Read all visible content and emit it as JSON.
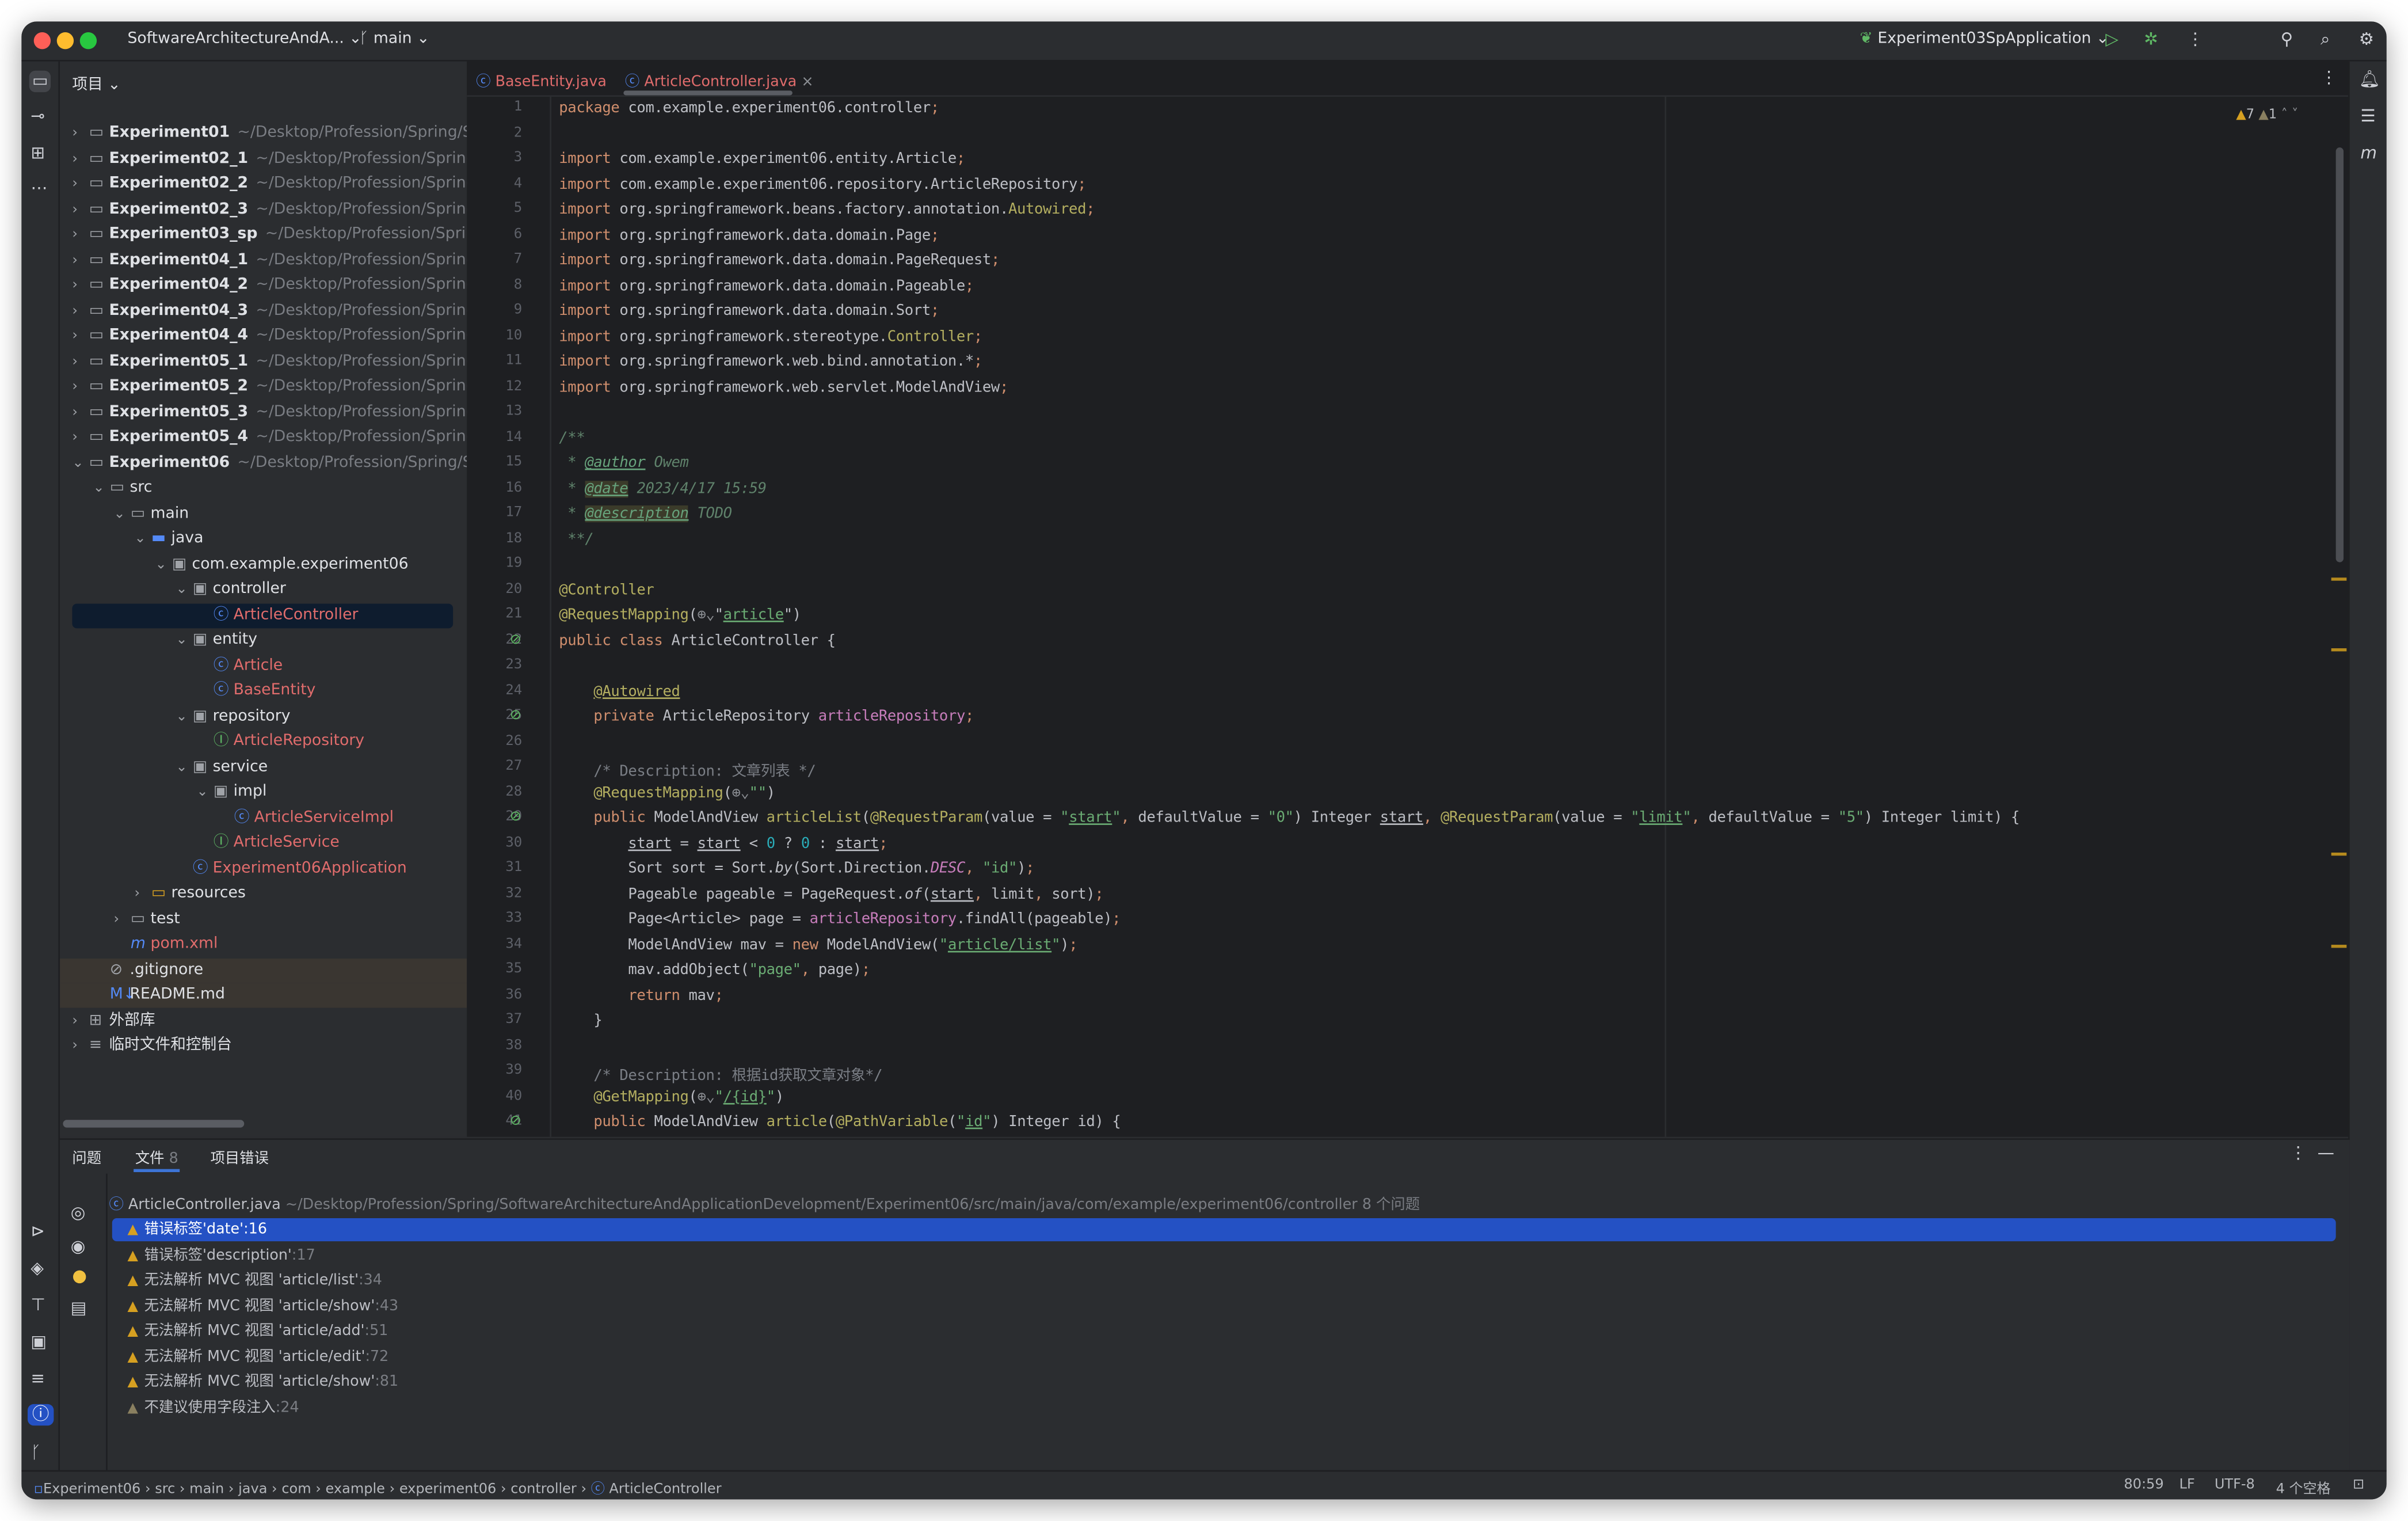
{
  "titlebar": {
    "project": "SoftwareArchitectureAndA...",
    "branch": "main",
    "run_config": "Experiment03SpApplication",
    "icons": [
      "run-icon",
      "debug-icon",
      "more-icon",
      "add-user-icon",
      "search-icon",
      "settings-icon"
    ]
  },
  "colors": {
    "accent": "#548af7",
    "selection": "#2451c4",
    "warning": "#d6a021",
    "error_file": "#e06c6c",
    "run": "#5fb865"
  },
  "project_panel": {
    "title": "项目",
    "tree": [
      {
        "depth": 0,
        "chev": ">",
        "icon": "module",
        "label": "Experiment01",
        "path": "~/Desktop/Profession/Spring/Softw",
        "bold": true
      },
      {
        "depth": 0,
        "chev": ">",
        "icon": "module",
        "label": "Experiment02_1",
        "path": "~/Desktop/Profession/Spring/Sof",
        "bold": true
      },
      {
        "depth": 0,
        "chev": ">",
        "icon": "module",
        "label": "Experiment02_2",
        "path": "~/Desktop/Profession/Spring/Sof",
        "bold": true
      },
      {
        "depth": 0,
        "chev": ">",
        "icon": "module",
        "label": "Experiment02_3",
        "path": "~/Desktop/Profession/Spring/Sof",
        "bold": true
      },
      {
        "depth": 0,
        "chev": ">",
        "icon": "module",
        "label": "Experiment03_sp",
        "path": "~/Desktop/Profession/Spring/Sc",
        "bold": true
      },
      {
        "depth": 0,
        "chev": ">",
        "icon": "module",
        "label": "Experiment04_1",
        "path": "~/Desktop/Profession/Spring/Sof",
        "bold": true
      },
      {
        "depth": 0,
        "chev": ">",
        "icon": "module",
        "label": "Experiment04_2",
        "path": "~/Desktop/Profession/Spring/Sof",
        "bold": true
      },
      {
        "depth": 0,
        "chev": ">",
        "icon": "module",
        "label": "Experiment04_3",
        "path": "~/Desktop/Profession/Spring/Sof",
        "bold": true
      },
      {
        "depth": 0,
        "chev": ">",
        "icon": "module",
        "label": "Experiment04_4",
        "path": "~/Desktop/Profession/Spring/Sof",
        "bold": true
      },
      {
        "depth": 0,
        "chev": ">",
        "icon": "module",
        "label": "Experiment05_1",
        "path": "~/Desktop/Profession/Spring/Sof",
        "bold": true
      },
      {
        "depth": 0,
        "chev": ">",
        "icon": "module",
        "label": "Experiment05_2",
        "path": "~/Desktop/Profession/Spring/Sof",
        "bold": true
      },
      {
        "depth": 0,
        "chev": ">",
        "icon": "module",
        "label": "Experiment05_3",
        "path": "~/Desktop/Profession/Spring/Sof",
        "bold": true
      },
      {
        "depth": 0,
        "chev": ">",
        "icon": "module",
        "label": "Experiment05_4",
        "path": "~/Desktop/Profession/Spring/Sof",
        "bold": true
      },
      {
        "depth": 0,
        "chev": "v",
        "icon": "module",
        "label": "Experiment06",
        "path": "~/Desktop/Profession/Spring/Softw",
        "bold": true
      },
      {
        "depth": 1,
        "chev": "v",
        "icon": "folder",
        "label": "src"
      },
      {
        "depth": 2,
        "chev": "v",
        "icon": "folder",
        "label": "main"
      },
      {
        "depth": 3,
        "chev": "v",
        "icon": "source-folder",
        "label": "java"
      },
      {
        "depth": 4,
        "chev": "v",
        "icon": "package",
        "label": "com.example.experiment06"
      },
      {
        "depth": 5,
        "chev": "v",
        "icon": "package",
        "label": "controller"
      },
      {
        "depth": 6,
        "chev": "",
        "icon": "class",
        "label": "ArticleController",
        "red": true,
        "selected": true
      },
      {
        "depth": 5,
        "chev": "v",
        "icon": "package",
        "label": "entity"
      },
      {
        "depth": 6,
        "chev": "",
        "icon": "class",
        "label": "Article",
        "red": true
      },
      {
        "depth": 6,
        "chev": "",
        "icon": "class",
        "label": "BaseEntity",
        "red": true
      },
      {
        "depth": 5,
        "chev": "v",
        "icon": "package",
        "label": "repository"
      },
      {
        "depth": 6,
        "chev": "",
        "icon": "interface",
        "label": "ArticleRepository",
        "red": true
      },
      {
        "depth": 5,
        "chev": "v",
        "icon": "package",
        "label": "service"
      },
      {
        "depth": 6,
        "chev": "v",
        "icon": "package",
        "label": "impl"
      },
      {
        "depth": 7,
        "chev": "",
        "icon": "class",
        "label": "ArticleServiceImpl",
        "red": true
      },
      {
        "depth": 6,
        "chev": "",
        "icon": "interface",
        "label": "ArticleService",
        "red": true
      },
      {
        "depth": 5,
        "chev": "",
        "icon": "spring-app",
        "label": "Experiment06Application",
        "red": true
      },
      {
        "depth": 3,
        "chev": ">",
        "icon": "resources-folder",
        "label": "resources"
      },
      {
        "depth": 2,
        "chev": ">",
        "icon": "folder",
        "label": "test"
      },
      {
        "depth": 2,
        "chev": "",
        "icon": "maven",
        "label": "pom.xml",
        "red": true
      },
      {
        "depth": 1,
        "chev": "",
        "icon": "ignore",
        "label": ".gitignore",
        "hl": true
      },
      {
        "depth": 1,
        "chev": "",
        "icon": "markdown",
        "label": "README.md",
        "hl": true
      },
      {
        "depth": 0,
        "chev": ">",
        "icon": "library",
        "label": "外部库"
      },
      {
        "depth": 0,
        "chev": ">",
        "icon": "scratches",
        "label": "临时文件和控制台"
      }
    ]
  },
  "editor": {
    "tabs": [
      {
        "label": "BaseEntity.java",
        "active": false
      },
      {
        "label": "ArticleController.java",
        "active": true
      }
    ],
    "inspections": {
      "warnings": "7",
      "weak_warnings": "1"
    },
    "lines": [
      [
        [
          "k",
          "package "
        ],
        [
          "t",
          "com.example.experiment06.controller"
        ],
        [
          "pn",
          ";"
        ]
      ],
      [],
      [
        [
          "k",
          "import "
        ],
        [
          "t",
          "com.example.experiment06.entity.Article"
        ],
        [
          "pn",
          ";"
        ]
      ],
      [
        [
          "k",
          "import "
        ],
        [
          "t",
          "com.example.experiment06.repository.ArticleRepository"
        ],
        [
          "pn",
          ";"
        ]
      ],
      [
        [
          "k",
          "import "
        ],
        [
          "t",
          "org.springframework.beans.factory.annotation."
        ],
        [
          "a",
          "Autowired"
        ],
        [
          "pn",
          ";"
        ]
      ],
      [
        [
          "k",
          "import "
        ],
        [
          "t",
          "org.springframework.data.domain.Page"
        ],
        [
          "pn",
          ";"
        ]
      ],
      [
        [
          "k",
          "import "
        ],
        [
          "t",
          "org.springframework.data.domain.PageRequest"
        ],
        [
          "pn",
          ";"
        ]
      ],
      [
        [
          "k",
          "import "
        ],
        [
          "t",
          "org.springframework.data.domain.Pageable"
        ],
        [
          "pn",
          ";"
        ]
      ],
      [
        [
          "k",
          "import "
        ],
        [
          "t",
          "org.springframework.data.domain.Sort"
        ],
        [
          "pn",
          ";"
        ]
      ],
      [
        [
          "k",
          "import "
        ],
        [
          "t",
          "org.springframework.stereotype."
        ],
        [
          "a",
          "Controller"
        ],
        [
          "pn",
          ";"
        ]
      ],
      [
        [
          "k",
          "import "
        ],
        [
          "t",
          "org.springframework.web.bind.annotation.*"
        ],
        [
          "pn",
          ";"
        ]
      ],
      [
        [
          "k",
          "import "
        ],
        [
          "t",
          "org.springframework.web.servlet.ModelAndView"
        ],
        [
          "pn",
          ";"
        ]
      ],
      [],
      [
        [
          "d",
          "/**"
        ]
      ],
      [
        [
          "d",
          " * "
        ],
        [
          "dt",
          "@author"
        ],
        [
          "d",
          " Owem"
        ]
      ],
      [
        [
          "d",
          " * "
        ],
        [
          "dh",
          "@date"
        ],
        [
          "d",
          " 2023/4/17 15:59"
        ]
      ],
      [
        [
          "d",
          " * "
        ],
        [
          "dh",
          "@description"
        ],
        [
          "d",
          " TODO"
        ]
      ],
      [
        [
          "d",
          " **/"
        ]
      ],
      [],
      [
        [
          "a",
          "@Controller"
        ]
      ],
      [
        [
          "a",
          "@RequestMapping"
        ],
        [
          "t",
          "("
        ],
        [
          "w",
          "⊕⌄"
        ],
        [
          "t",
          "\""
        ],
        [
          "su",
          "article"
        ],
        [
          "t",
          "\")"
        ]
      ],
      [
        [
          "k",
          "public class "
        ],
        [
          "t",
          "ArticleController {"
        ]
      ],
      [],
      [
        [
          "t",
          "    "
        ],
        [
          "a u",
          "@Autowired"
        ]
      ],
      [
        [
          "t",
          "    "
        ],
        [
          "k",
          "private "
        ],
        [
          "t",
          "ArticleRepository "
        ],
        [
          "p",
          "articleRepository"
        ],
        [
          "pn",
          ";"
        ]
      ],
      [],
      [
        [
          "c",
          "    /* Description: 文章列表 */"
        ]
      ],
      [
        [
          "t",
          "    "
        ],
        [
          "a",
          "@RequestMapping"
        ],
        [
          "t",
          "("
        ],
        [
          "w",
          "⊕⌄"
        ],
        [
          "s",
          "\"\""
        ],
        [
          "t",
          ")"
        ]
      ],
      [
        [
          "t",
          "    "
        ],
        [
          "k",
          "public "
        ],
        [
          "t",
          "ModelAndView "
        ],
        [
          "a",
          "articleList"
        ],
        [
          "t",
          "("
        ],
        [
          "a",
          "@RequestParam"
        ],
        [
          "t",
          "(value = "
        ],
        [
          "s",
          "\""
        ],
        [
          "su",
          "start"
        ],
        [
          "s",
          "\""
        ],
        [
          "pn",
          ", "
        ],
        [
          "t",
          "defaultValue = "
        ],
        [
          "s",
          "\"0\""
        ],
        [
          "t",
          ") Integer "
        ],
        [
          "t u",
          "start"
        ],
        [
          "pn",
          ", "
        ],
        [
          "a",
          "@RequestParam"
        ],
        [
          "t",
          "(value = "
        ],
        [
          "s",
          "\""
        ],
        [
          "su",
          "limit"
        ],
        [
          "s",
          "\""
        ],
        [
          "pn",
          ", "
        ],
        [
          "t",
          "defaultValue = "
        ],
        [
          "s",
          "\"5\""
        ],
        [
          "t",
          ") Integer limit) {"
        ]
      ],
      [
        [
          "t",
          "        "
        ],
        [
          "t u",
          "start"
        ],
        [
          "t",
          " = "
        ],
        [
          "t u",
          "start"
        ],
        [
          "t",
          " < "
        ],
        [
          "n",
          "0"
        ],
        [
          "t",
          " ? "
        ],
        [
          "n",
          "0"
        ],
        [
          "t",
          " : "
        ],
        [
          "t u",
          "start"
        ],
        [
          "pn",
          ";"
        ]
      ],
      [
        [
          "t",
          "        Sort sort = Sort."
        ],
        [
          "t i",
          "by"
        ],
        [
          "t",
          "(Sort.Direction."
        ],
        [
          "p i",
          "DESC"
        ],
        [
          "pn",
          ", "
        ],
        [
          "s",
          "\"id\""
        ],
        [
          "t",
          ")"
        ],
        [
          "pn",
          ";"
        ]
      ],
      [
        [
          "t",
          "        Pageable pageable = PageRequest."
        ],
        [
          "t i",
          "of"
        ],
        [
          "t",
          "("
        ],
        [
          "t u",
          "start"
        ],
        [
          "pn",
          ", "
        ],
        [
          "t",
          "limit"
        ],
        [
          "pn",
          ", "
        ],
        [
          "t",
          "sort)"
        ],
        [
          "pn",
          ";"
        ]
      ],
      [
        [
          "t",
          "        Page<Article> page = "
        ],
        [
          "p",
          "articleRepository"
        ],
        [
          "t",
          ".findAll(pageable)"
        ],
        [
          "pn",
          ";"
        ]
      ],
      [
        [
          "t",
          "        ModelAndView mav = "
        ],
        [
          "k",
          "new "
        ],
        [
          "t",
          "ModelAndView("
        ],
        [
          "s",
          "\""
        ],
        [
          "su",
          "article/list"
        ],
        [
          "s",
          "\""
        ],
        [
          "t",
          ")"
        ],
        [
          "pn",
          ";"
        ]
      ],
      [
        [
          "t",
          "        mav.addObject("
        ],
        [
          "s",
          "\"page\""
        ],
        [
          "pn",
          ", "
        ],
        [
          "t",
          "page)"
        ],
        [
          "pn",
          ";"
        ]
      ],
      [
        [
          "t",
          "        "
        ],
        [
          "k",
          "return "
        ],
        [
          "t",
          "mav"
        ],
        [
          "pn",
          ";"
        ]
      ],
      [
        [
          "t",
          "    }"
        ]
      ],
      [],
      [
        [
          "c",
          "    /* Description: 根据id获取文章对象*/"
        ]
      ],
      [
        [
          "t",
          "    "
        ],
        [
          "a",
          "@GetMapping"
        ],
        [
          "t",
          "("
        ],
        [
          "w",
          "⊕⌄"
        ],
        [
          "s",
          "\""
        ],
        [
          "su",
          "/{id}"
        ],
        [
          "s",
          "\""
        ],
        [
          "t",
          ")"
        ]
      ],
      [
        [
          "t",
          "    "
        ],
        [
          "k",
          "public "
        ],
        [
          "t",
          "ModelAndView "
        ],
        [
          "a",
          "article"
        ],
        [
          "t",
          "("
        ],
        [
          "a",
          "@PathVariable"
        ],
        [
          "t",
          "("
        ],
        [
          "s",
          "\""
        ],
        [
          "su",
          "id"
        ],
        [
          "s",
          "\""
        ],
        [
          "t",
          ") Integer id) {"
        ]
      ]
    ],
    "gutter_icons": [
      {
        "line": 22,
        "icon": "bean-icon"
      },
      {
        "line": 25,
        "icon": "autowired-icon"
      },
      {
        "line": 29,
        "icon": "web-endpoint-icon"
      },
      {
        "line": 41,
        "icon": "web-endpoint-icon"
      }
    ]
  },
  "problems": {
    "tabs": [
      {
        "label": "问题"
      },
      {
        "label": "文件",
        "count": "8",
        "active": true
      },
      {
        "label": "项目错误"
      }
    ],
    "file": {
      "name": "ArticleController.java",
      "path": "~/Desktop/Profession/Spring/SoftwareArchitectureAndApplicationDevelopment/Experiment06/src/main/java/com/example/experiment06/controller",
      "count": "8 个问题"
    },
    "items": [
      {
        "text": "错误标签'date'",
        "line": ":16",
        "selected": true
      },
      {
        "text": "错误标签'description'",
        "line": ":17"
      },
      {
        "text": "无法解析 MVC 视图 'article/list'",
        "line": ":34"
      },
      {
        "text": "无法解析 MVC 视图 'article/show'",
        "line": ":43"
      },
      {
        "text": "无法解析 MVC 视图 'article/add'",
        "line": ":51"
      },
      {
        "text": "无法解析 MVC 视图 'article/edit'",
        "line": ":72"
      },
      {
        "text": "无法解析 MVC 视图 'article/show'",
        "line": ":81"
      },
      {
        "text": "不建议使用字段注入",
        "line": ":24",
        "weak": true
      }
    ]
  },
  "statusbar": {
    "breadcrumb": [
      "Experiment06",
      "src",
      "main",
      "java",
      "com",
      "example",
      "experiment06",
      "controller",
      "ArticleController"
    ],
    "position": "80:59",
    "line_sep": "LF",
    "encoding": "UTF-8",
    "indent": "4 个空格"
  }
}
